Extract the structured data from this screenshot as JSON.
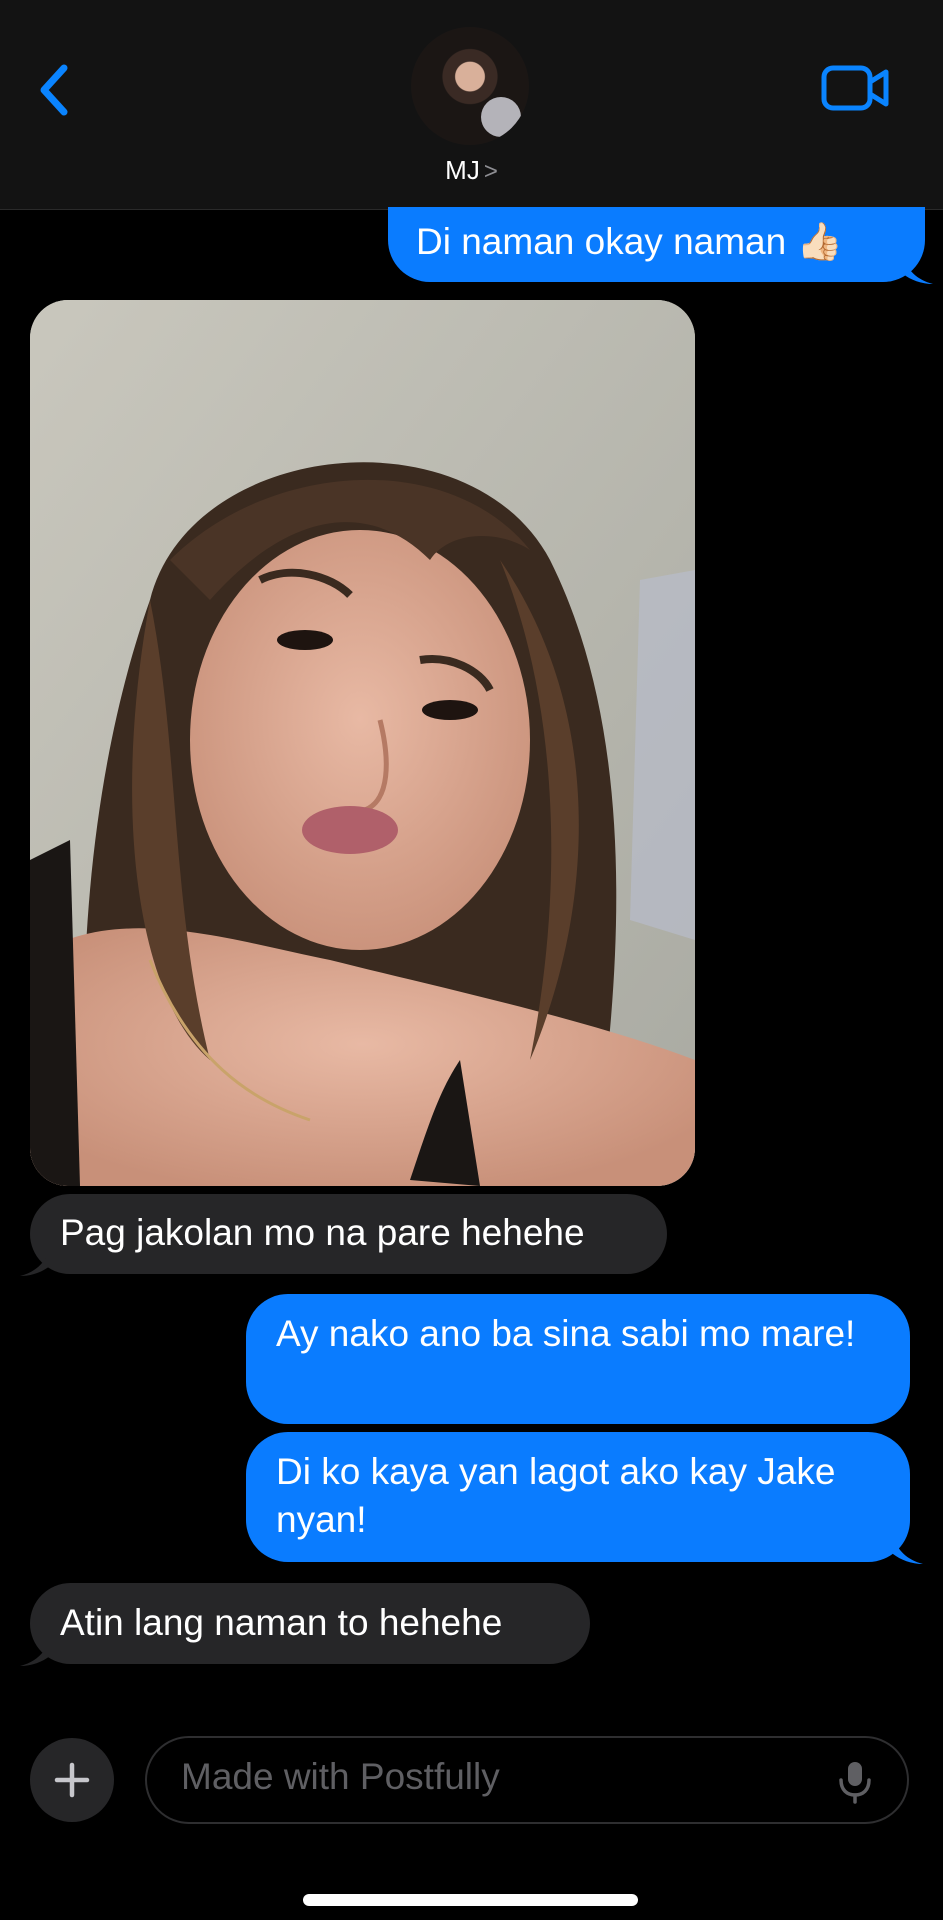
{
  "header": {
    "contact_name": "MJ",
    "chevron": ">"
  },
  "messages": [
    {
      "direction": "outgoing",
      "text": "Di naman okay naman 👍🏻"
    },
    {
      "direction": "incoming",
      "type": "image"
    },
    {
      "direction": "incoming",
      "text": "Pag jakolan mo na pare hehehe"
    },
    {
      "direction": "outgoing",
      "text": "Ay nako ano ba sina sabi mo mare!"
    },
    {
      "direction": "outgoing",
      "text": "Di ko kaya yan lagot ako kay Jake nyan!"
    },
    {
      "direction": "incoming",
      "text": "Atin lang naman to hehehe"
    }
  ],
  "composer": {
    "placeholder": "Made with Postfully"
  },
  "colors": {
    "outgoing_bubble": "#0a7cff",
    "incoming_bubble": "#262628",
    "accent": "#0a84ff",
    "background": "#000000"
  }
}
